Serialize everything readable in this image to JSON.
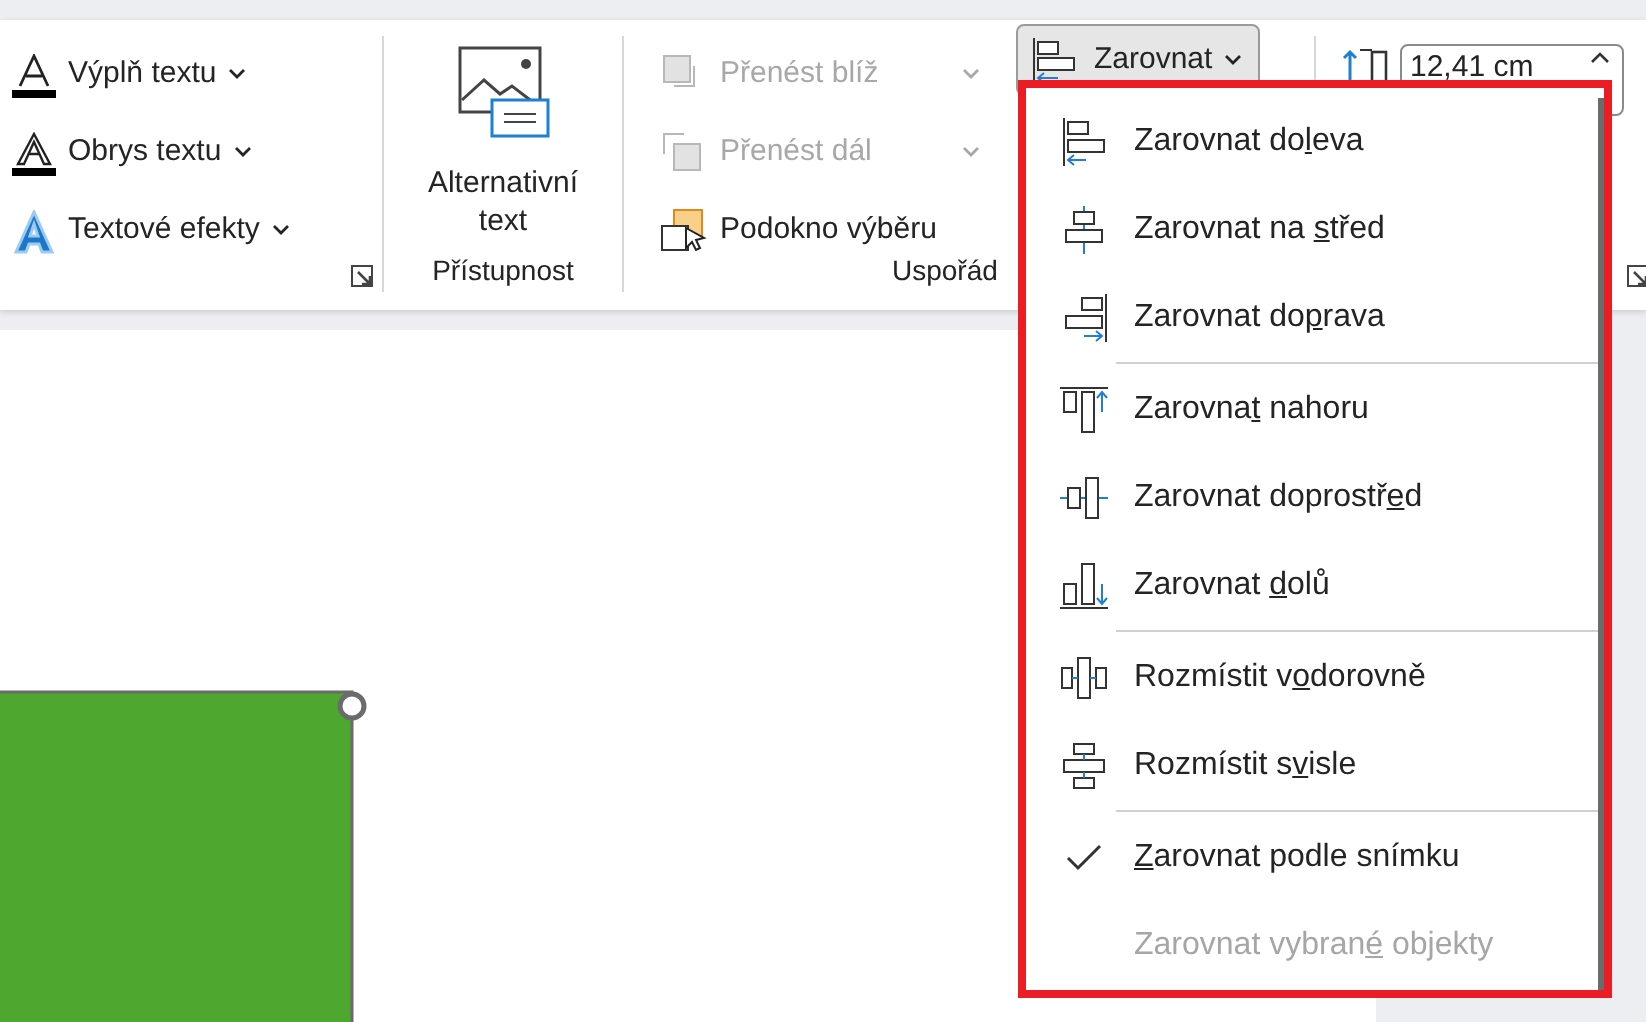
{
  "ribbon": {
    "groups": [
      {
        "kind": "wordart",
        "items": [
          {
            "label": "Výplň textu",
            "disabled": false,
            "dropdown": true
          },
          {
            "label": "Obrys textu",
            "disabled": false,
            "dropdown": true
          },
          {
            "label": "Textové efekty",
            "disabled": false,
            "dropdown": true
          }
        ],
        "launcher": true
      },
      {
        "kind": "big",
        "label": "Přístupnost",
        "button": {
          "label": "Alternativní text"
        }
      },
      {
        "kind": "arrange",
        "label": "Uspořád",
        "items": [
          {
            "label": "Přenést blíž",
            "disabled": true,
            "dropdown": true
          },
          {
            "label": "Přenést dál",
            "disabled": true,
            "dropdown": true
          },
          {
            "label": "Podokno výběru",
            "disabled": false,
            "dropdown": false
          }
        ],
        "align_button": {
          "label": "Zarovnat",
          "pressed": true
        }
      },
      {
        "kind": "size",
        "field": {
          "value": "12,41 cm"
        },
        "launcher": true
      }
    ]
  },
  "align_menu": {
    "sections": [
      [
        {
          "label_parts": [
            {
              "text": "Zarovnat do",
              "underlined": false
            },
            {
              "text": "l",
              "underlined": true
            },
            {
              "text": "eva",
              "underlined": false
            }
          ],
          "checked": false,
          "disabled": false
        },
        {
          "label_parts": [
            {
              "text": "Zarovnat na ",
              "underlined": false
            },
            {
              "text": "s",
              "underlined": true
            },
            {
              "text": "třed",
              "underlined": false
            }
          ],
          "checked": false,
          "disabled": false
        },
        {
          "label_parts": [
            {
              "text": "Zarovnat do",
              "underlined": false
            },
            {
              "text": "p",
              "underlined": true
            },
            {
              "text": "rava",
              "underlined": false
            }
          ],
          "checked": false,
          "disabled": false
        }
      ],
      [
        {
          "label_parts": [
            {
              "text": "Zarovna",
              "underlined": false
            },
            {
              "text": "t",
              "underlined": true
            },
            {
              "text": " nahoru",
              "underlined": false
            }
          ],
          "checked": false,
          "disabled": false
        },
        {
          "label_parts": [
            {
              "text": "Zarovnat doprostř",
              "underlined": false
            },
            {
              "text": "e",
              "underlined": true
            },
            {
              "text": "d",
              "underlined": false
            }
          ],
          "checked": false,
          "disabled": false
        },
        {
          "label_parts": [
            {
              "text": "Zarovnat ",
              "underlined": false
            },
            {
              "text": "d",
              "underlined": true
            },
            {
              "text": "olů",
              "underlined": false
            }
          ],
          "checked": false,
          "disabled": false
        }
      ],
      [
        {
          "label_parts": [
            {
              "text": "Rozmístit v",
              "underlined": false
            },
            {
              "text": "o",
              "underlined": true
            },
            {
              "text": "dorovně",
              "underlined": false
            }
          ],
          "checked": false,
          "disabled": false
        },
        {
          "label_parts": [
            {
              "text": "Rozmístit s",
              "underlined": false
            },
            {
              "text": "v",
              "underlined": true
            },
            {
              "text": "isle",
              "underlined": false
            }
          ],
          "checked": false,
          "disabled": false
        }
      ],
      [
        {
          "label_parts": [
            {
              "text": "Z",
              "underlined": true
            },
            {
              "text": "arovnat podle snímku",
              "underlined": false
            }
          ],
          "checked": true,
          "disabled": false
        },
        {
          "label_parts": [
            {
              "text": "Zarovnat vybran",
              "underlined": false
            },
            {
              "text": "é",
              "underlined": true
            },
            {
              "text": " objekty",
              "underlined": false
            }
          ],
          "checked": false,
          "disabled": true
        }
      ]
    ]
  },
  "slide": {
    "shape": {
      "color": "#4ea72e",
      "selected": true
    }
  }
}
